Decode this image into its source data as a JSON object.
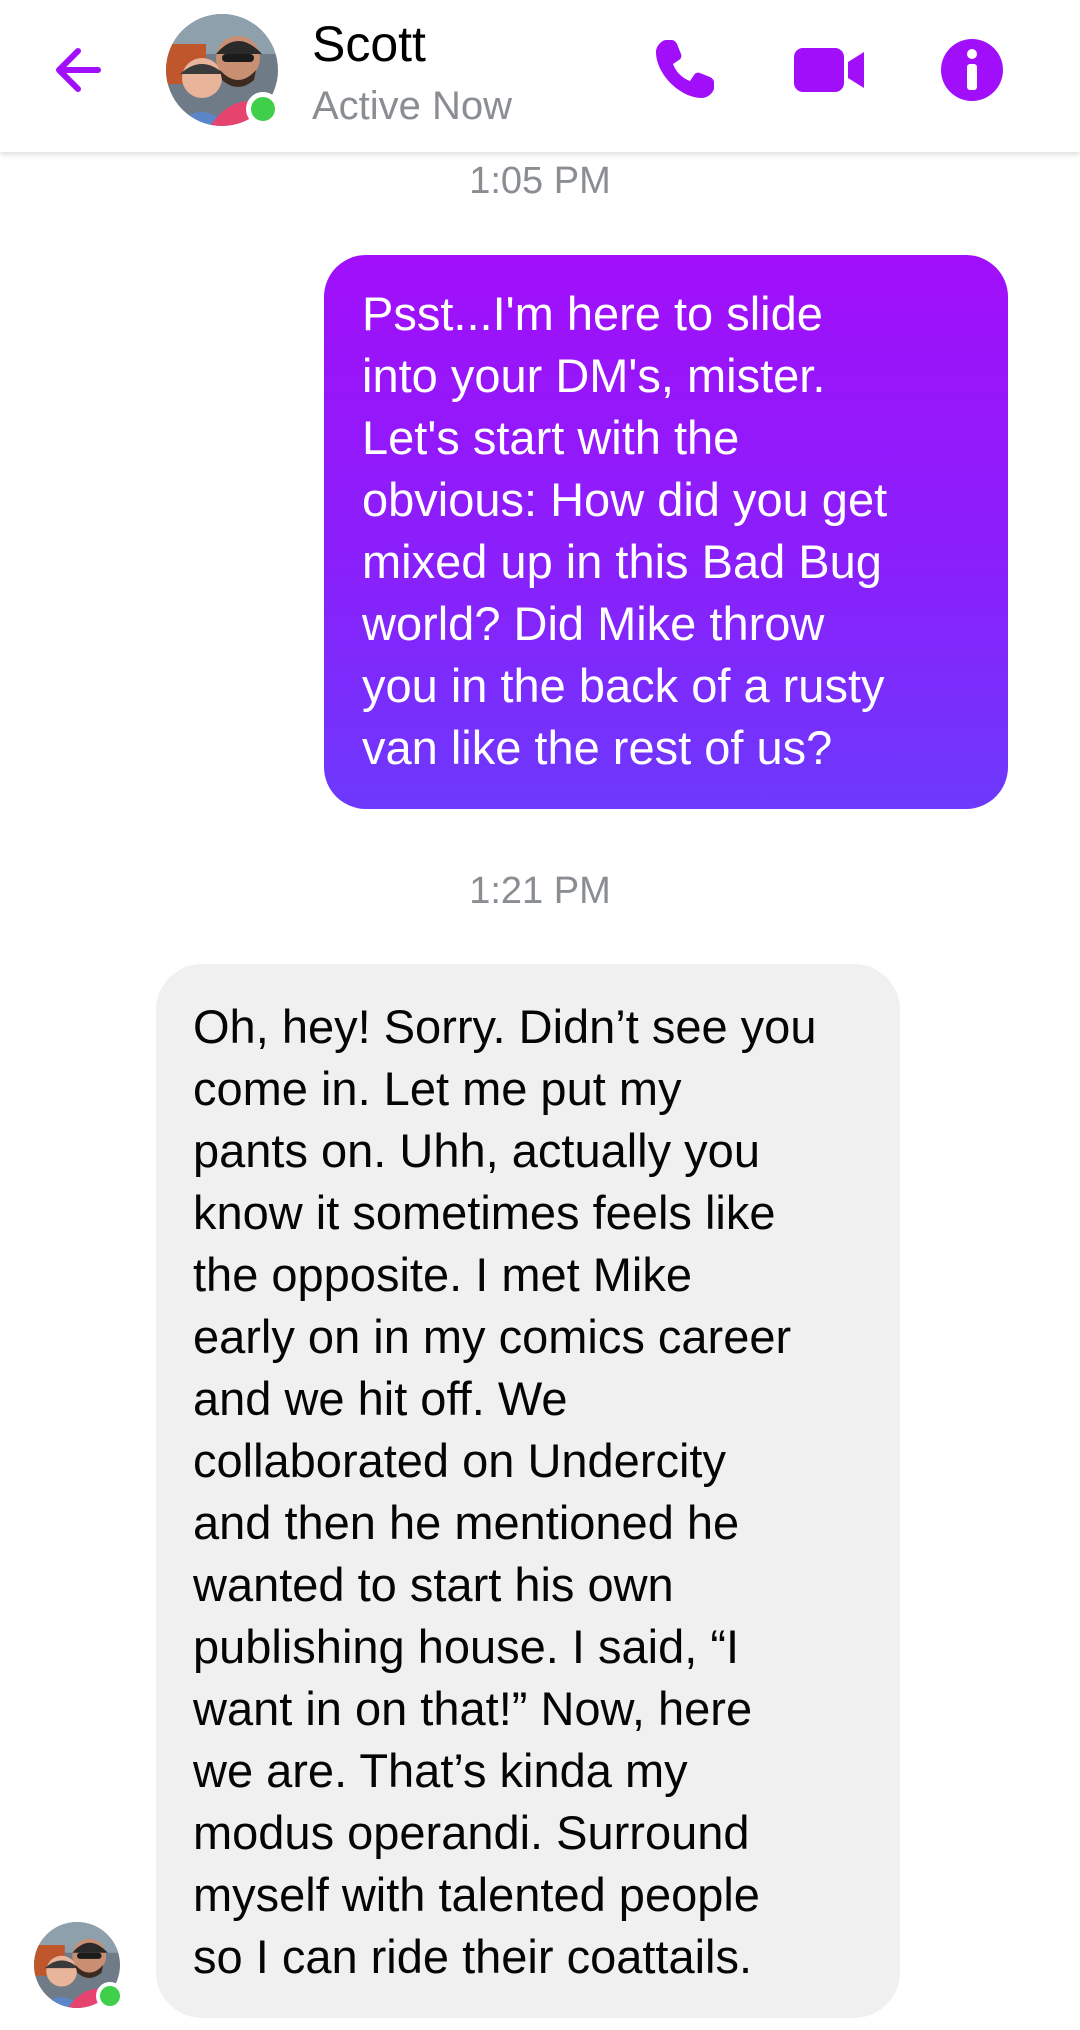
{
  "header": {
    "contact_name": "Scott",
    "status": "Active Now",
    "back_icon": "back-arrow-icon",
    "call_icon": "phone-icon",
    "video_icon": "video-camera-icon",
    "info_icon": "info-icon",
    "accent_color": "#a10ffa",
    "online_color": "#3fcf4a"
  },
  "messages": [
    {
      "timestamp": "1:05 PM",
      "direction": "outgoing",
      "text": "Psst...I'm here to slide\ninto your DM's, mister.\nLet's start with the\nobvious: How did you get\nmixed up in this Bad Bug\nworld? Did Mike throw\nyou in the back of a rusty\nvan like the rest of us?"
    },
    {
      "timestamp": "1:21 PM",
      "direction": "incoming",
      "text": "Oh, hey! Sorry. Didn’t see you\ncome in. Let me put my\npants on. Uhh, actually you\nknow it sometimes feels like\nthe opposite. I met Mike\nearly on in my comics career\nand we hit off. We\ncollaborated on Undercity\nand then he mentioned he\nwanted to start his own\npublishing house. I said, “I\nwant in on that!” Now, here\nwe are. That’s kinda my\nmodus operandi. Surround\nmyself with talented people\nso I can ride their coattails."
    }
  ]
}
